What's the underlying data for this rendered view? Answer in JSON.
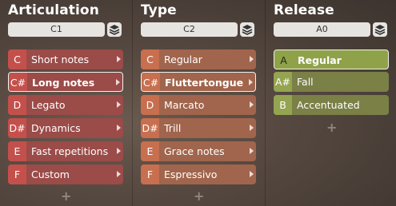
{
  "columns": [
    {
      "title": "Articulation",
      "selector_value": "C1",
      "items": [
        {
          "key": "C",
          "label": "Short notes",
          "selected": false
        },
        {
          "key": "C#",
          "label": "Long notes",
          "selected": true
        },
        {
          "key": "D",
          "label": "Legato",
          "selected": false
        },
        {
          "key": "D#",
          "label": "Dynamics",
          "selected": false
        },
        {
          "key": "E",
          "label": "Fast repetitions",
          "selected": false
        },
        {
          "key": "F",
          "label": "Custom",
          "selected": false
        }
      ],
      "add_label": "+"
    },
    {
      "title": "Type",
      "selector_value": "C2",
      "items": [
        {
          "key": "C",
          "label": "Regular",
          "selected": false
        },
        {
          "key": "C#",
          "label": "Fluttertongue",
          "selected": true
        },
        {
          "key": "D",
          "label": "Marcato",
          "selected": false
        },
        {
          "key": "D#",
          "label": "Trill",
          "selected": false
        },
        {
          "key": "E",
          "label": "Grace notes",
          "selected": false
        },
        {
          "key": "F",
          "label": "Espressivo",
          "selected": false
        }
      ],
      "add_label": "+"
    },
    {
      "title": "Release",
      "selector_value": "A0",
      "items": [
        {
          "key": "A",
          "label": "Regular",
          "selected": true
        },
        {
          "key": "A#",
          "label": "Fall",
          "selected": false
        },
        {
          "key": "B",
          "label": "Accentuated",
          "selected": false
        }
      ],
      "add_label": "+"
    }
  ],
  "icons": {
    "stack": "layers-icon",
    "arrow": "triangle-right-icon",
    "add": "plus-icon"
  },
  "colors": {
    "articulation_row": "#9b4b48",
    "articulation_key": "#c4504c",
    "type_row": "#a0654c",
    "type_key": "#c76f4f",
    "release_row": "#7a8046",
    "release_key": "#94a450"
  }
}
